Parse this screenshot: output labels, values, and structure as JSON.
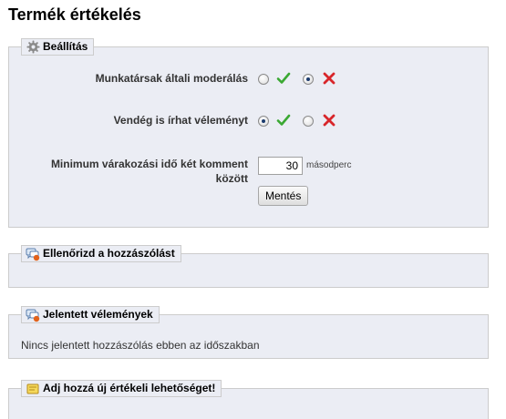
{
  "page": {
    "title": "Termék értékelés"
  },
  "settings": {
    "legend": "Beállítás",
    "rows": [
      {
        "label": "Munkatársak általi moderálás",
        "selected": "no"
      },
      {
        "label": "Vendég is írhat véleményt",
        "selected": "yes"
      }
    ],
    "min_wait": {
      "label_line1": "Minimum várakozási idő két komment",
      "label_line2": "között",
      "value": "30",
      "unit": "másodperc"
    },
    "save_label": "Mentés"
  },
  "check_comments": {
    "legend": "Ellenőrizd a hozzászólást"
  },
  "reported": {
    "legend": "Jelentett vélemények",
    "empty_text": "Nincs jelentett hozzászólás ebben az időszakban"
  },
  "add_criterion": {
    "legend": "Adj hozzá új értékeli lehetőséget!"
  },
  "colors": {
    "panel_bg": "#ebedf4",
    "yes": "#3aa832",
    "no": "#d8262a"
  },
  "icons": {
    "settings": "gear-icon",
    "comments": "comment-warning-icon",
    "add": "note-icon",
    "yes": "checkmark-icon",
    "no": "cross-icon"
  }
}
